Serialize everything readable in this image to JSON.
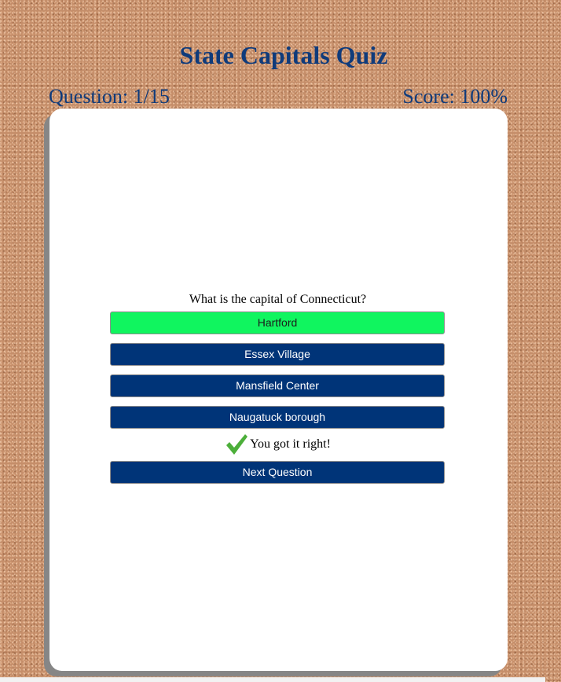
{
  "title": "State Capitals Quiz",
  "progress": {
    "question_label": "Question: 1/15",
    "score_label": "Score: 100%"
  },
  "question": {
    "text": "What is the capital of Connecticut?",
    "answers": [
      {
        "label": "Hartford",
        "state": "correct"
      },
      {
        "label": "Essex Village",
        "state": "default"
      },
      {
        "label": "Mansfield Center",
        "state": "default"
      },
      {
        "label": "Naugatuck borough",
        "state": "default"
      }
    ]
  },
  "feedback": {
    "icon": "checkmark-icon",
    "text": "You got it right!"
  },
  "next_button": {
    "label": "Next Question"
  },
  "colors": {
    "heading": "#0f3b7b",
    "button": "#003478",
    "correct": "#10f55f",
    "check": "#4caf3a"
  }
}
